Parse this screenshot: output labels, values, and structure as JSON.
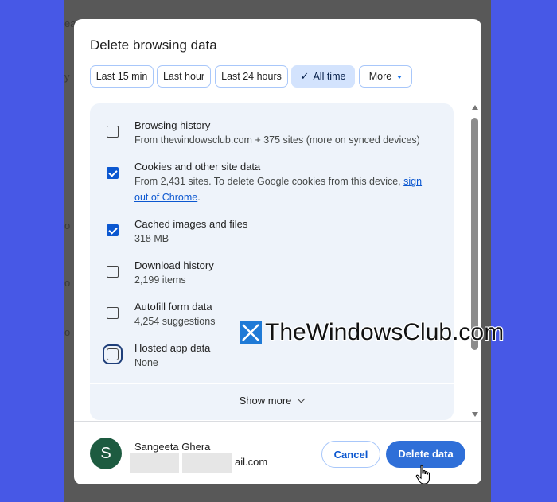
{
  "background": {
    "fragments": [
      "ea",
      "y",
      "o",
      "o",
      "o"
    ]
  },
  "dialog": {
    "title": "Delete browsing data",
    "time_ranges": [
      {
        "label": "Last 15 min",
        "selected": false
      },
      {
        "label": "Last hour",
        "selected": false
      },
      {
        "label": "Last 24 hours",
        "selected": false
      },
      {
        "label": "All time",
        "selected": true
      },
      {
        "label": "More",
        "selected": false
      }
    ],
    "items": [
      {
        "title": "Browsing history",
        "subtitle": "From thewindowsclub.com + 375 sites (more on synced devices)",
        "checked": false
      },
      {
        "title": "Cookies and other site data",
        "subtitle": "From 2,431 sites. To delete Google cookies from this device,",
        "link": "sign out of Chrome",
        "link_suffix": ".",
        "checked": true
      },
      {
        "title": "Cached images and files",
        "subtitle": "318 MB",
        "checked": true
      },
      {
        "title": "Download history",
        "subtitle": "2,199 items",
        "checked": false
      },
      {
        "title": "Autofill form data",
        "subtitle": "4,254 suggestions",
        "checked": false
      },
      {
        "title": "Hosted app data",
        "subtitle": "None",
        "checked": false
      }
    ],
    "show_more_label": "Show more",
    "account": {
      "avatar_letter": "S",
      "name": "Sangeeta Ghera",
      "email_visible_tail": "ail.com",
      "avatar_color": "#1d5b40"
    },
    "cancel_label": "Cancel",
    "delete_label": "Delete data"
  },
  "watermark": {
    "text": "TheWindowsClub.com"
  },
  "colors": {
    "accent": "#0b57d0",
    "primary_button": "#2f6fd8",
    "selected_chip": "#d3e3fd",
    "list_bg": "#eef3fa",
    "page_bg": "#4758e6"
  }
}
